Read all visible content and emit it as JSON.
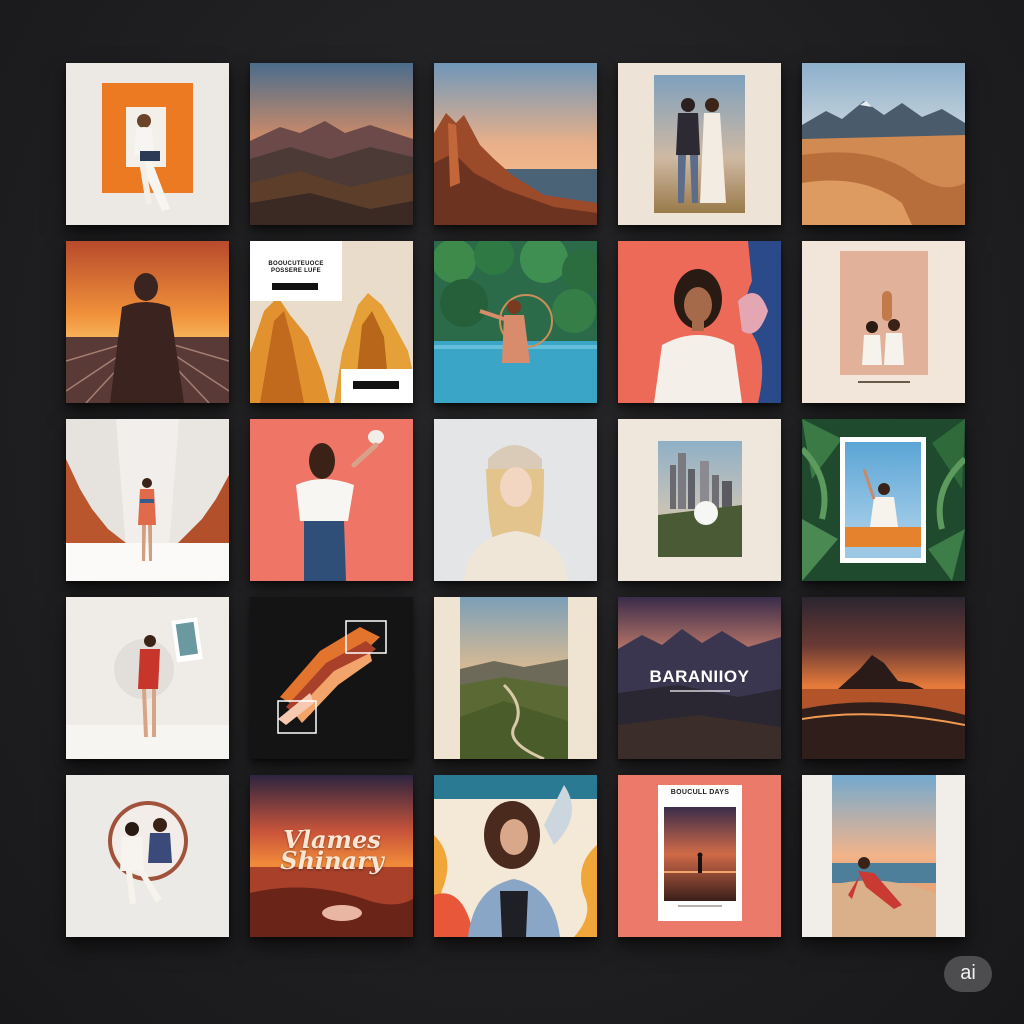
{
  "collage": {
    "rows": 5,
    "columns": 5,
    "tiles": [
      {
        "id": "r1c1",
        "subject": "woman-sitting-orange-frame"
      },
      {
        "id": "r1c2",
        "subject": "mountain-valley-sunset"
      },
      {
        "id": "r1c3",
        "subject": "red-rock-cliffs-sea"
      },
      {
        "id": "r1c4",
        "subject": "couple-portrait-framed"
      },
      {
        "id": "r1c5",
        "subject": "desert-dunes-mountains"
      },
      {
        "id": "r2c1",
        "subject": "person-sunset-road"
      },
      {
        "id": "r2c2",
        "subject": "poster-orange-rock-shapes"
      },
      {
        "id": "r2c3",
        "subject": "woman-infinity-pool"
      },
      {
        "id": "r2c4",
        "subject": "woman-portrait-coral"
      },
      {
        "id": "r2c5",
        "subject": "two-people-framed"
      },
      {
        "id": "r3c1",
        "subject": "woman-white-room-red-rocks"
      },
      {
        "id": "r3c2",
        "subject": "woman-coral-wall"
      },
      {
        "id": "r3c3",
        "subject": "blonde-woman-beanie"
      },
      {
        "id": "r3c4",
        "subject": "city-skyline-framed"
      },
      {
        "id": "r3c5",
        "subject": "woman-tropical-leaves"
      },
      {
        "id": "r4c1",
        "subject": "woman-red-dress-white-room"
      },
      {
        "id": "r4c2",
        "subject": "abstract-orange-wave"
      },
      {
        "id": "r4c3",
        "subject": "winding-road-landscape"
      },
      {
        "id": "r4c4",
        "subject": "mountain-title-poster"
      },
      {
        "id": "r4c5",
        "subject": "sunset-rock-reflection"
      },
      {
        "id": "r5c1",
        "subject": "two-girls-circle"
      },
      {
        "id": "r5c2",
        "subject": "script-title-sunset"
      },
      {
        "id": "r5c3",
        "subject": "woman-denim-jacket-art"
      },
      {
        "id": "r5c4",
        "subject": "poster-silhouette-sunset"
      },
      {
        "id": "r5c5",
        "subject": "woman-beach-sunset"
      }
    ]
  },
  "texts": {
    "r2c2_heading": "BOOUCUTEUOCE\nPOSSERE LUFE",
    "r4c4_title": "BARANIIOY",
    "r5c2_script": "Vlames\nShinary",
    "r5c4_heading": "BOUCULL DAYS"
  },
  "badge": {
    "label": "ai"
  },
  "colors": {
    "background": "#1f1f21",
    "accent_orange": "#e8782a",
    "coral": "#ec7a6a",
    "cream": "#ede3d6"
  }
}
